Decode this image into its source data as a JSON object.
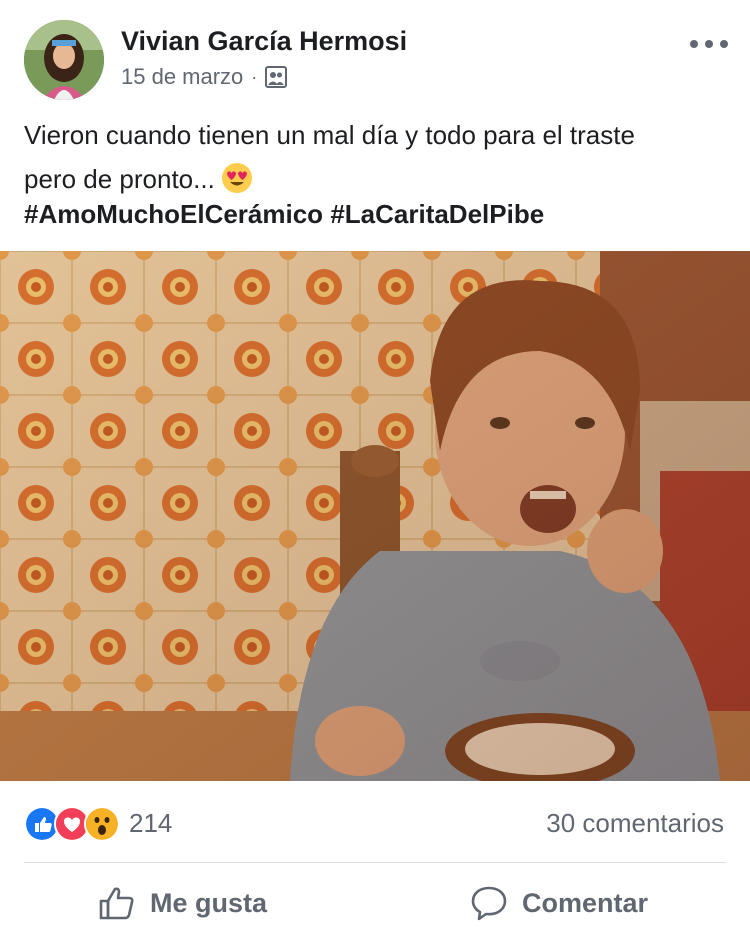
{
  "post": {
    "author": "Vivian García Hermosi",
    "date": "15 de marzo",
    "separator": "·",
    "audience_icon": "friends-icon",
    "text_line1": "Vieron cuando tienen un mal día y todo para el traste",
    "text_line2": "pero de pronto...",
    "emoji": "heart-eyes-emoji",
    "hashtag1": "#AmoMuchoElCerámico",
    "hashtag2": "#LaCaritaDelPibe"
  },
  "reactions": {
    "icons": [
      "like-icon",
      "love-icon",
      "wow-icon"
    ],
    "count": "214",
    "comments": "30 comentarios"
  },
  "actions": {
    "like_label": "Me gusta",
    "comment_label": "Comentar"
  },
  "colors": {
    "like": "#1877f2",
    "love": "#f33e58",
    "wow": "#f7b125",
    "secondary_text": "#606770"
  }
}
